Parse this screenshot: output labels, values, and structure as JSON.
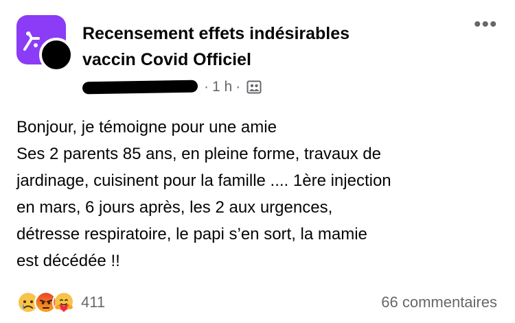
{
  "post": {
    "group_name_line1": "Recensement effets indésirables",
    "group_name_line2": "vaccin Covid Officiel",
    "time": "1 h",
    "separator": "·",
    "more_label": "•••",
    "body_lines": [
      "Bonjour, je témoigne pour une amie",
      "Ses 2 parents 85 ans, en pleine forme, travaux de",
      "jardinage, cuisinent pour la famille .... 1ère injection",
      "en mars, 6 jours après, les 2 aux urgences,",
      "détresse respiratoire, le papi s’en sort, la mamie",
      "est décédée !!"
    ],
    "reaction_count": "411",
    "comments_label": "66 commentaires"
  },
  "colors": {
    "group_avatar_bg": "#8b3cf6",
    "secondary_text": "#65676b",
    "primary_text": "#050505"
  },
  "icons": {
    "reactions": [
      "sad-emoji-icon",
      "angry-emoji-icon",
      "care-emoji-icon"
    ],
    "privacy": "members-privacy-icon",
    "more": "more-options-icon"
  }
}
